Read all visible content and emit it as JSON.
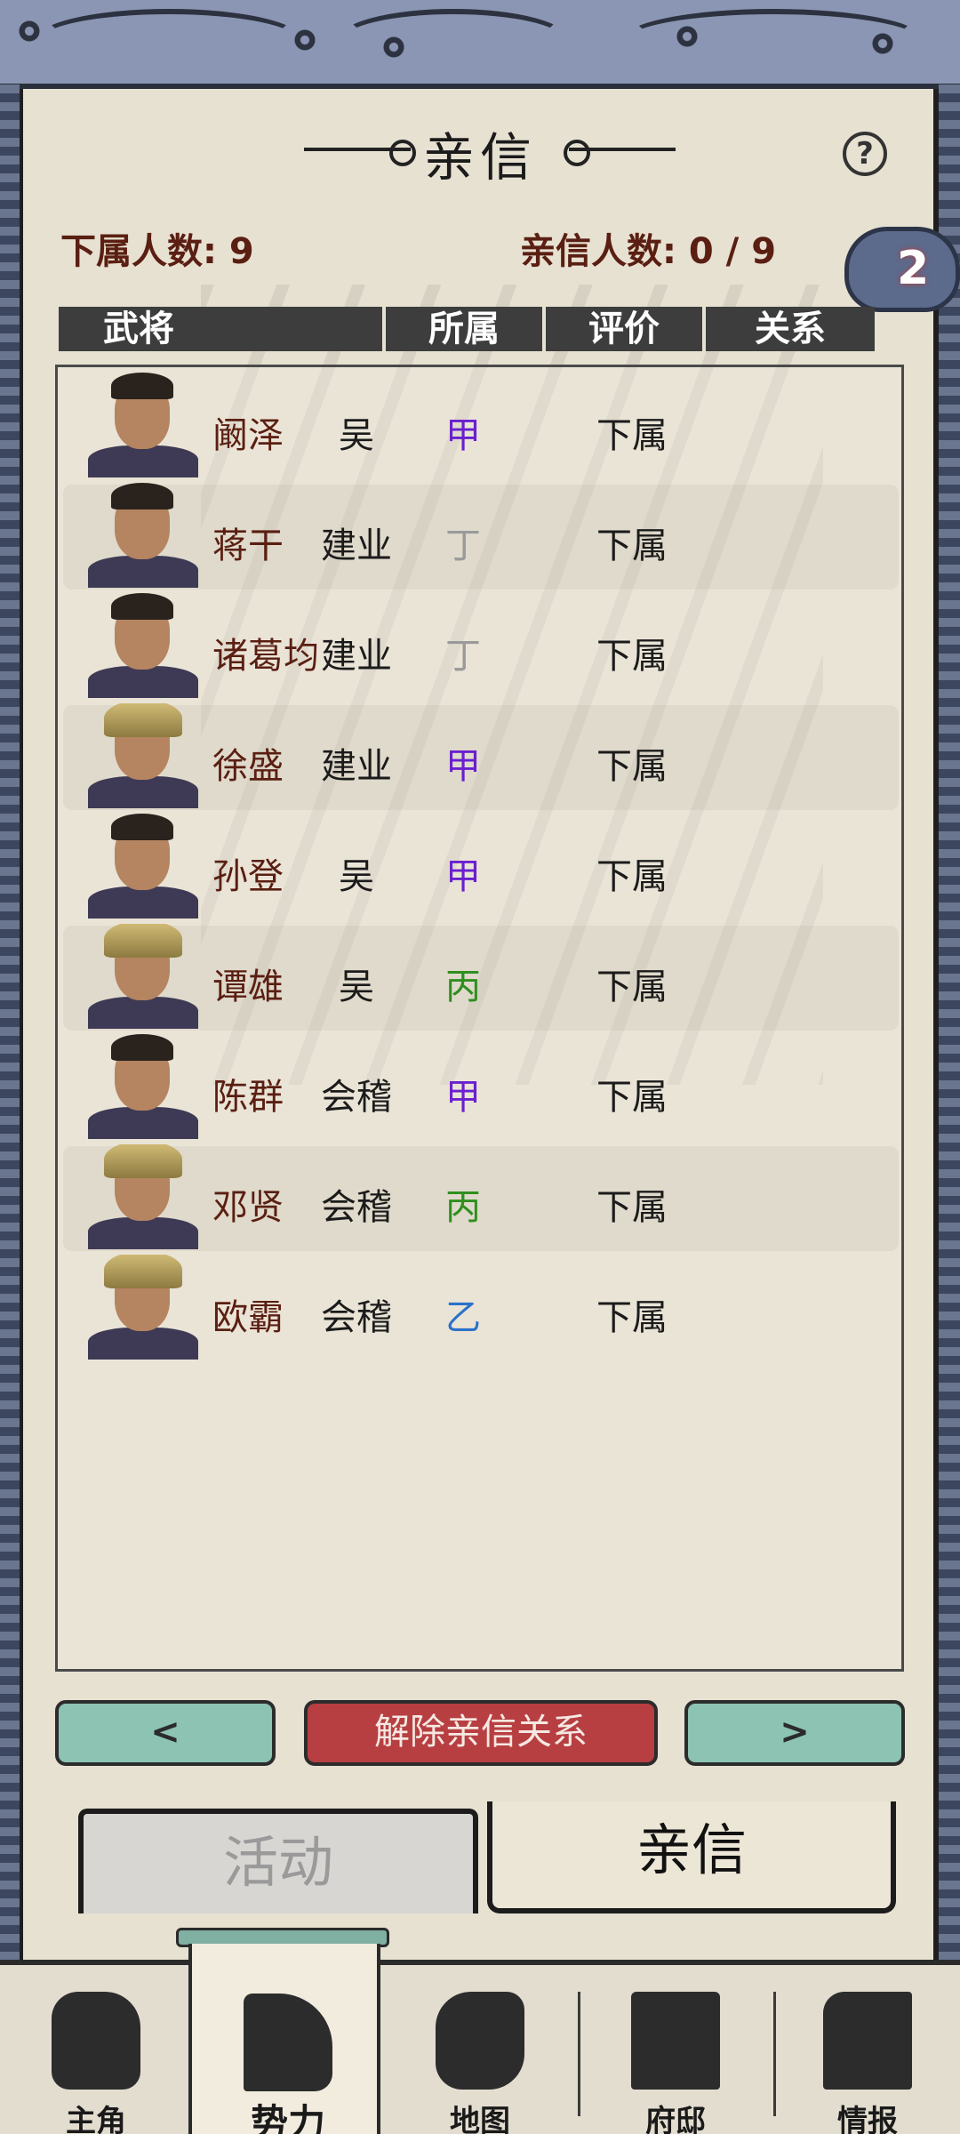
{
  "header": {
    "title": "亲信",
    "help_icon": "question-mark-icon",
    "subordinate_count_label": "下属人数: 9",
    "confidant_count_label": "亲信人数: 0 / 9",
    "badge_count": "2"
  },
  "table": {
    "columns": [
      "武将",
      "所属",
      "评价",
      "关系"
    ],
    "rows": [
      {
        "name": "阚泽",
        "affiliation": "吴",
        "grade": "甲",
        "relation": "下属",
        "grade_color": "#6a1fcf",
        "portrait": "civil"
      },
      {
        "name": "蒋干",
        "affiliation": "建业",
        "grade": "丁",
        "relation": "下属",
        "grade_color": "#9a9a9a",
        "portrait": "civil"
      },
      {
        "name": "诸葛均",
        "affiliation": "建业",
        "grade": "丁",
        "relation": "下属",
        "grade_color": "#9a9a9a",
        "portrait": "civil"
      },
      {
        "name": "徐盛",
        "affiliation": "建业",
        "grade": "甲",
        "relation": "下属",
        "grade_color": "#6a1fcf",
        "portrait": "armored"
      },
      {
        "name": "孙登",
        "affiliation": "吴",
        "grade": "甲",
        "relation": "下属",
        "grade_color": "#6a1fcf",
        "portrait": "civil"
      },
      {
        "name": "谭雄",
        "affiliation": "吴",
        "grade": "丙",
        "relation": "下属",
        "grade_color": "#2f8f1f",
        "portrait": "armored"
      },
      {
        "name": "陈群",
        "affiliation": "会稽",
        "grade": "甲",
        "relation": "下属",
        "grade_color": "#6a1fcf",
        "portrait": "civil"
      },
      {
        "name": "邓贤",
        "affiliation": "会稽",
        "grade": "丙",
        "relation": "下属",
        "grade_color": "#2f8f1f",
        "portrait": "armored"
      },
      {
        "name": "欧霸",
        "affiliation": "会稽",
        "grade": "乙",
        "relation": "下属",
        "grade_color": "#2a72c9",
        "portrait": "armored"
      }
    ]
  },
  "actions": {
    "prev_label": "<",
    "dismiss_label": "解除亲信关系",
    "next_label": ">"
  },
  "subtabs": [
    "活动",
    "亲信"
  ],
  "bottom_nav": [
    {
      "label": "主角",
      "icon": "warrior-icon"
    },
    {
      "label": "势力",
      "icon": "flag-icon"
    },
    {
      "label": "地图",
      "icon": "map-icon"
    },
    {
      "label": "府邸",
      "icon": "mansion-icon"
    },
    {
      "label": "情报",
      "icon": "scroll-icon"
    }
  ],
  "colors": {
    "paper": "#e7e1d2",
    "header_bar": "#3d3d3d",
    "name_text": "#5a1f12",
    "nav_button": "#8cc3b3",
    "danger_button": "#b73f42"
  }
}
